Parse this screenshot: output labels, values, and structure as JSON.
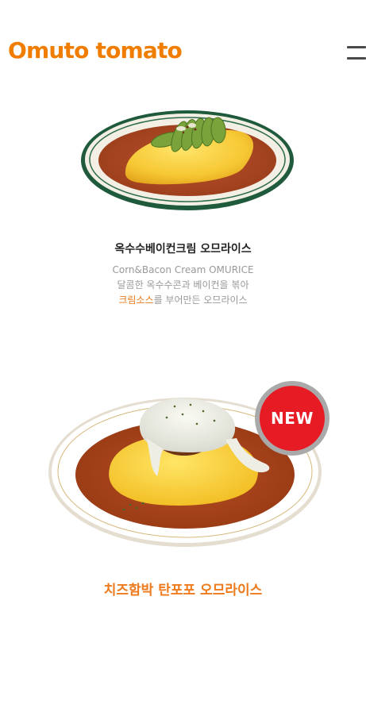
{
  "header": {
    "logo_text": "Omuto tomato",
    "menu_icon": "hamburger-icon"
  },
  "colors": {
    "brand_orange": "#f07c00",
    "highlight_orange": "#e9781b",
    "badge_red": "#e61b24",
    "badge_ring": "#a9a9a9",
    "text_gray": "#999999",
    "plate_green": "#1f5a3c"
  },
  "items": [
    {
      "title": "옥수수베이컨크림 오므라이스",
      "english_name": "Corn&Bacon Cream OMURICE",
      "desc_line1": "달콤한 옥수수콘과 베이컨을 볶아",
      "desc_line2_highlight": "크림소스",
      "desc_line2_rest": "를 부어만든 오므라이스"
    },
    {
      "badge": "NEW",
      "title": "치즈함박 탄포포 오므라이스"
    }
  ]
}
